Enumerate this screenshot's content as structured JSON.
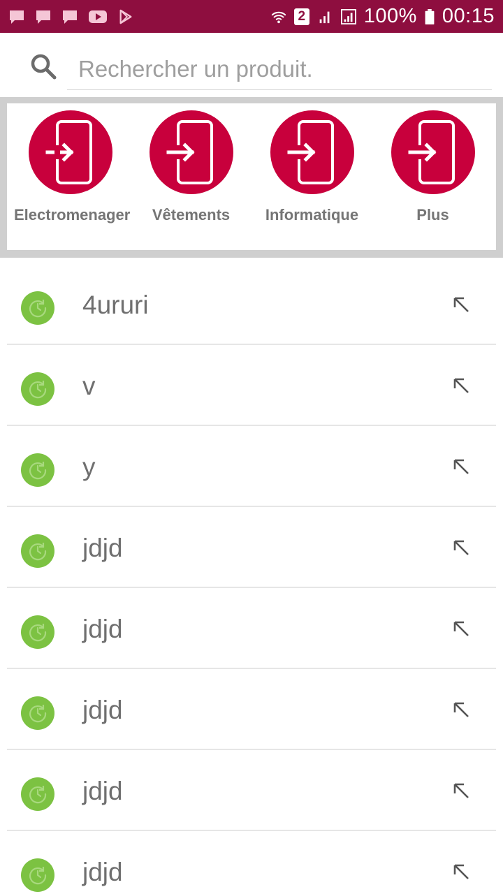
{
  "status_bar": {
    "sim_number": "2",
    "battery": "100%",
    "time": "00:15",
    "icons": [
      "message-icon",
      "message-icon",
      "message-icon",
      "youtube-icon",
      "play-store-icon",
      "wifi-icon",
      "signal-icon",
      "signal-icon",
      "battery-icon"
    ]
  },
  "search": {
    "placeholder": "Rechercher un produit.",
    "value": ""
  },
  "categories": [
    {
      "label": "Electromenager",
      "icon": "login-phone-icon"
    },
    {
      "label": "Vêtements",
      "icon": "login-phone-icon"
    },
    {
      "label": "Informatique",
      "icon": "login-phone-icon"
    },
    {
      "label": "Plus",
      "icon": "login-phone-icon"
    }
  ],
  "history": [
    {
      "text": "4ururi",
      "icon": "history-icon"
    },
    {
      "text": "v",
      "icon": "history-icon"
    },
    {
      "text": "y",
      "icon": "history-icon"
    },
    {
      "text": "jdjd",
      "icon": "history-icon"
    },
    {
      "text": "jdjd",
      "icon": "history-icon"
    },
    {
      "text": "jdjd",
      "icon": "history-icon"
    },
    {
      "text": "jdjd",
      "icon": "history-icon"
    },
    {
      "text": "jdjd",
      "icon": "history-icon"
    }
  ],
  "colors": {
    "status_bar": "#8e0e3f",
    "category_circle": "#c8003c",
    "history_icon": "#7cc242",
    "panel_border": "#cfcfcf"
  }
}
